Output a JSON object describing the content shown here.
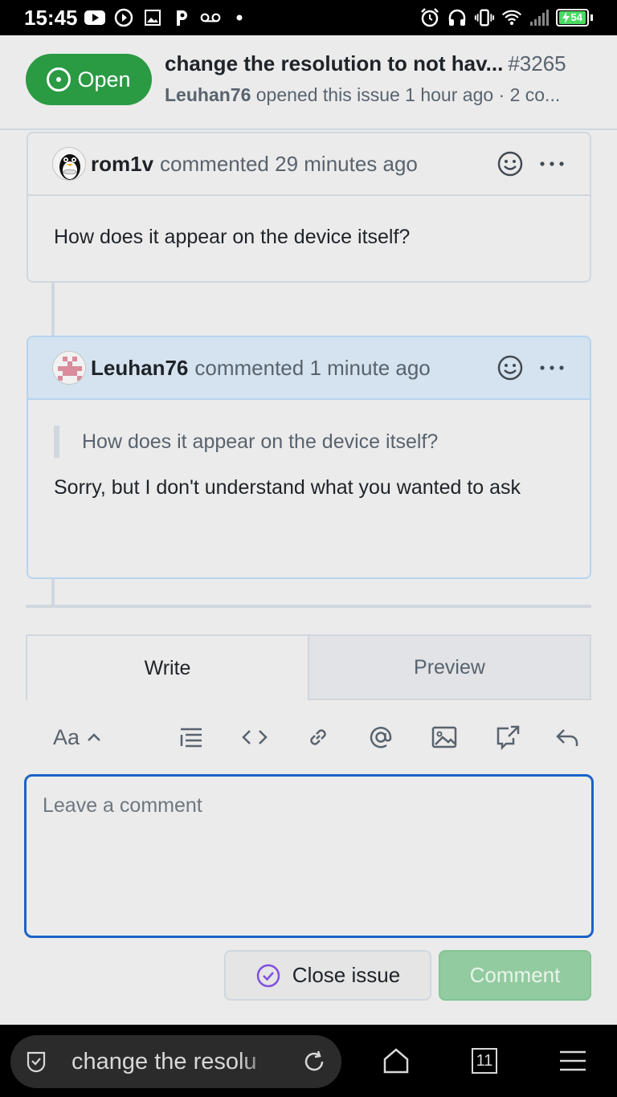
{
  "status_bar": {
    "time": "15:45",
    "battery": "54"
  },
  "header": {
    "state_label": "Open",
    "title": "change the resolution to not hav...",
    "number": "#3265",
    "author": "Leuhan76",
    "meta": "opened this issue 1 hour ago · 2 co..."
  },
  "comments": [
    {
      "author": "rom1v",
      "action": "commented 29 minutes ago",
      "body": "How does it appear on the device itself?"
    },
    {
      "author": "Leuhan76",
      "action": "commented 1 minute ago",
      "quote": "How does it appear on the device itself?",
      "body": "Sorry, but I don't understand what you wanted to ask"
    }
  ],
  "editor": {
    "tabs": [
      "Write",
      "Preview"
    ],
    "format_label": "Aa",
    "placeholder": "Leave a comment"
  },
  "actions": {
    "close_label": "Close issue",
    "comment_label": "Comment"
  },
  "browser": {
    "url_text": "change the resolu",
    "tab_count": "11"
  },
  "colors": {
    "open_green": "#2a9a43",
    "focus_blue": "#1a63c7",
    "comment_green_disabled": "#93cba0"
  }
}
